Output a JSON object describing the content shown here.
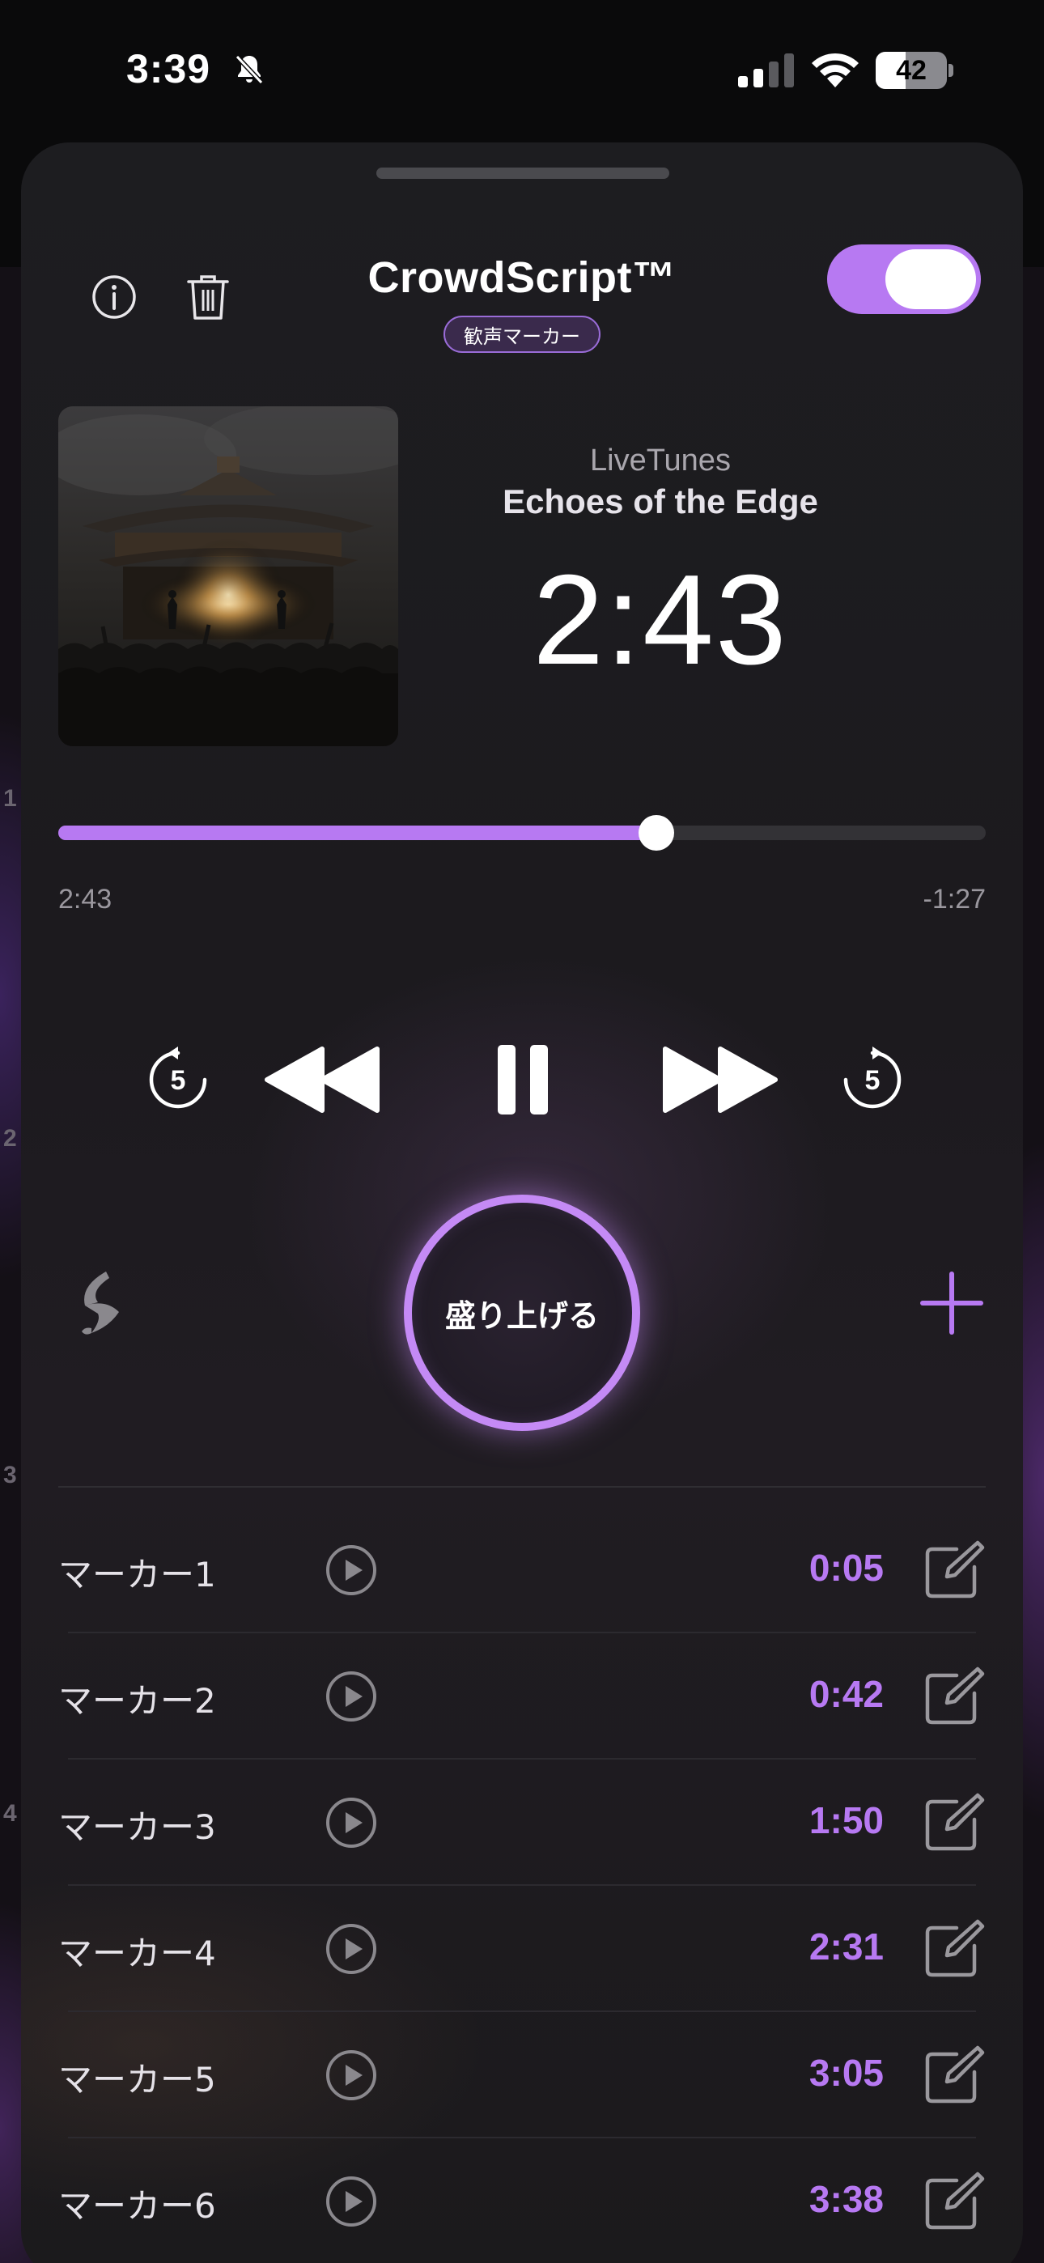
{
  "status_bar": {
    "time": "3:39",
    "battery": "42",
    "battery_level_percent": 42
  },
  "background": {
    "side_numbers": [
      "1",
      "2",
      "3",
      "4"
    ]
  },
  "header": {
    "title": "CrowdScript™",
    "subtitle_badge": "歓声マーカー",
    "toggle_on": true,
    "accent_color": "#b779f2"
  },
  "now_playing": {
    "app_name": "LiveTunes",
    "track_title": "Echoes of the Edge",
    "current_time_large": "2:43"
  },
  "progress": {
    "elapsed": "2:43",
    "remaining": "-1:27",
    "fraction": 0.645
  },
  "transport": {
    "skip_back_seconds": "5",
    "skip_forward_seconds": "5"
  },
  "cheer_button": {
    "label": "盛り上げる"
  },
  "markers": [
    {
      "name": "マーカー1",
      "time": "0:05"
    },
    {
      "name": "マーカー2",
      "time": "0:42"
    },
    {
      "name": "マーカー3",
      "time": "1:50"
    },
    {
      "name": "マーカー4",
      "time": "2:31"
    },
    {
      "name": "マーカー5",
      "time": "3:05"
    },
    {
      "name": "マーカー6",
      "time": "3:38"
    }
  ]
}
